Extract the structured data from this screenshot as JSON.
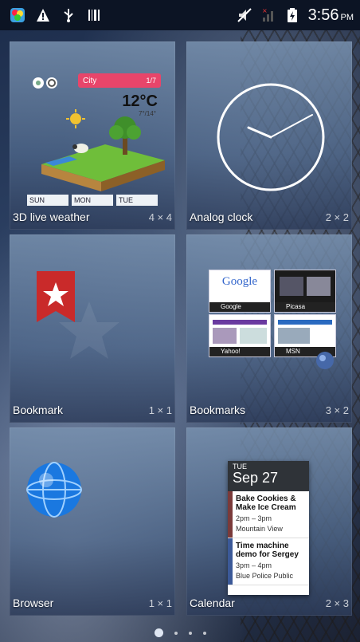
{
  "status_bar": {
    "time": "3:56",
    "ampm": "PM",
    "left_icons": [
      "app-icon",
      "warning-icon",
      "usb-icon",
      "barcode-icon"
    ],
    "right_icons": [
      "mute-icon",
      "no-signal-icon",
      "battery-charging-icon"
    ]
  },
  "widgets": [
    {
      "label": "3D live weather",
      "size": "4 × 4"
    },
    {
      "label": "Analog clock",
      "size": "2 × 2"
    },
    {
      "label": "Bookmark",
      "size": "1 × 1"
    },
    {
      "label": "Bookmarks",
      "size": "3 × 2"
    },
    {
      "label": "Browser",
      "size": "1 × 1"
    },
    {
      "label": "Calendar",
      "size": "2 × 3"
    }
  ],
  "weather_preview": {
    "city": "City",
    "page": "1/7",
    "temp": "12°C",
    "range": "7°/14°",
    "days": [
      "SUN",
      "MON",
      "TUE"
    ]
  },
  "bookmarks_preview": {
    "thumbs": [
      {
        "title": "Google",
        "logo": "Google"
      },
      {
        "title": "Picasa"
      },
      {
        "title": "Yahoo!"
      },
      {
        "title": "MSN"
      }
    ]
  },
  "calendar_preview": {
    "dow": "TUE",
    "date": "Sep 27",
    "events": [
      {
        "title1": "Bake Cookies &",
        "title2": "Make Ice Cream",
        "time": "2pm – 3pm",
        "location": "Mountain View",
        "color": "#7a3a3a"
      },
      {
        "title1": "Time machine",
        "title2": "demo for Sergey",
        "time": "3pm – 4pm",
        "location": "Blue Police Public",
        "color": "#3b5998"
      }
    ]
  },
  "pager": {
    "pages": 4,
    "active": 0
  }
}
